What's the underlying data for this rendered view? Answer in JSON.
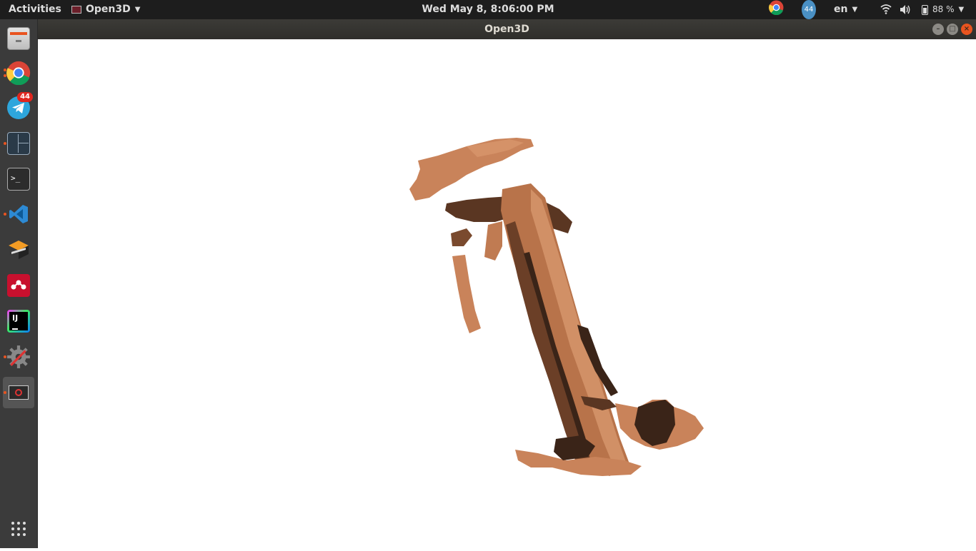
{
  "topbar": {
    "activities": "Activities",
    "app_menu": "Open3D",
    "clock": "Wed May  8,  8:06:00 PM",
    "telegram_count": "44",
    "language": "en",
    "battery": "88 %"
  },
  "window": {
    "title": "Open3D",
    "minimize_icon": "minimize-icon",
    "maximize_icon": "maximize-icon",
    "close_icon": "close-icon"
  },
  "dock": {
    "items": [
      {
        "name": "files",
        "icon": "file-cabinet-icon"
      },
      {
        "name": "chrome",
        "icon": "chrome-icon"
      },
      {
        "name": "telegram",
        "icon": "telegram-icon",
        "badge": "44"
      },
      {
        "name": "terminator",
        "icon": "split-terminal-icon"
      },
      {
        "name": "terminal",
        "icon": "terminal-icon"
      },
      {
        "name": "vscode",
        "icon": "vscode-icon"
      },
      {
        "name": "sublime-merge",
        "icon": "box-icon"
      },
      {
        "name": "mendeley",
        "icon": "mendeley-icon"
      },
      {
        "name": "intellij",
        "icon": "intellij-icon"
      },
      {
        "name": "settings",
        "icon": "gear-icon"
      },
      {
        "name": "open3d",
        "icon": "open3d-window-icon"
      }
    ],
    "show_apps_icon": "app-grid-icon"
  },
  "colors": {
    "accent": "#e95420",
    "point_light": "#c9835a",
    "point_dark": "#3a2418"
  }
}
